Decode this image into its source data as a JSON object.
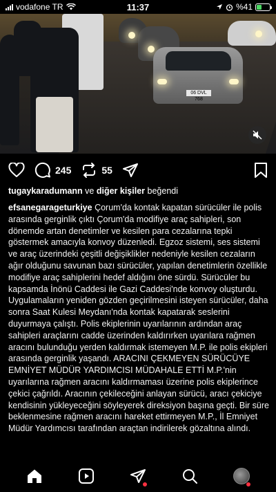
{
  "status_bar": {
    "carrier": "vodafone TR",
    "time": "11:37",
    "battery_percent": "%41",
    "battery_level": 0.41
  },
  "video": {
    "plate_text": "06 DVL 768",
    "mute_icon": "speaker-muted-icon"
  },
  "actions": {
    "comment_count": "245",
    "repost_count": "55"
  },
  "likes": {
    "user": "tugaykaradumann",
    "connector": "ve",
    "others": "diğer kişiler",
    "suffix": "beğendi"
  },
  "caption": {
    "username": "efsanegarageturkiye",
    "text": "Çorum'da kontak kapatan sürücüler ile polis arasında gerginlik çıktı Çorum'da modifiye araç sahipleri, son dönemde artan denetimler ve kesilen para cezalarına tepki göstermek amacıyla konvoy düzenledi. Egzoz sistemi, ses sistemi ve araç üzerindeki çeşitli değişiklikler nedeniyle kesilen cezaların ağır olduğunu savunan bazı sürücüler, yapılan denetimlerin özellikle modifiye araç sahiplerini hedef aldığını öne sürdü. Sürücüler bu kapsamda İnönü Caddesi ile Gazi Caddesi'nde konvoy oluşturdu. Uygulamaların yeniden gözden geçirilmesini isteyen sürücüler, daha sonra Saat Kulesi Meydanı'nda kontak kapatarak seslerini duyurmaya çalıştı. Polis ekiplerinin uyarılarının ardından araç sahipleri araçlarını cadde üzerinden kaldırırken uyarılara rağmen aracını bulunduğu yerden kaldırmak istemeyen M.P. ile polis ekipleri arasında gerginlik yaşandı. ARACINI ÇEKMEYEN SÜRÜCÜYE EMNİYET MÜDÜR YARDIMCISI MÜDAHALE ETTİ M.P.'nin uyarılarına rağmen aracını kaldırmaması üzerine polis ekiplerince çekici çağrıldı. Aracının çekileceğini anlayan sürücü, aracı çekiciye kendisinin yükleyeceğini söyleyerek direksiyon başına geçti. Bir süre beklenmesine rağmen aracını hareket ettirmeyen M.P., İl Emniyet Müdür Yardımcısı tarafından araçtan indirilerek gözaltına alındı."
  },
  "tabbar": {
    "items": [
      "home-icon",
      "reels-icon",
      "send-icon",
      "search-icon",
      "profile-avatar"
    ]
  }
}
